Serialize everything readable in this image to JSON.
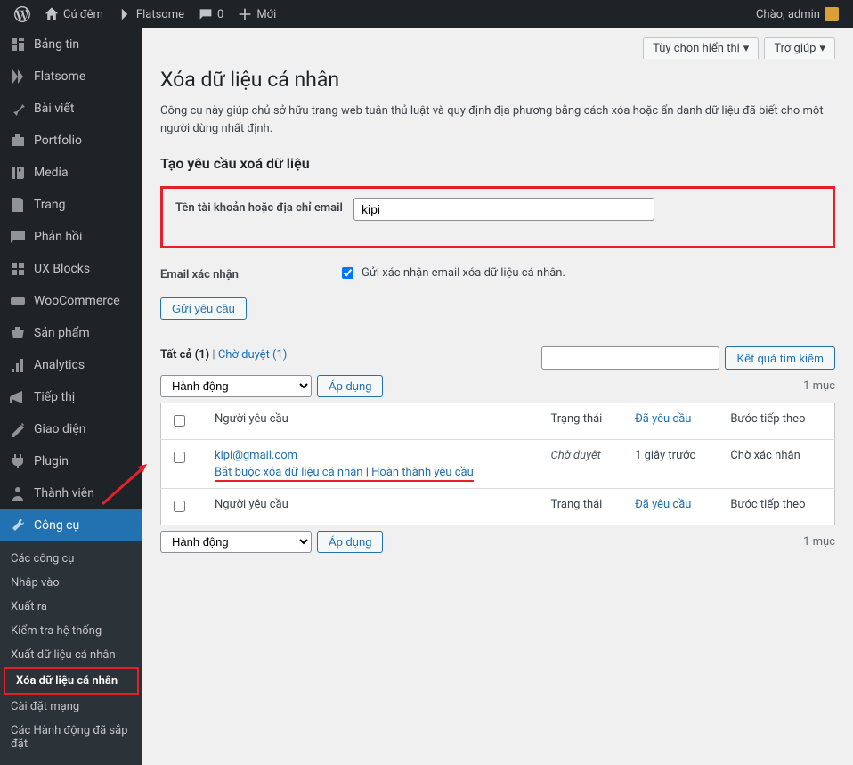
{
  "toolbar": {
    "site_name": "Cú đêm",
    "customize": "Flatsome",
    "comments_count": "0",
    "new": "Mới",
    "greeting": "Chào, admin"
  },
  "sidebar": {
    "items": [
      {
        "icon": "dashboard",
        "label": "Bảng tin"
      },
      {
        "icon": "flatsome",
        "label": "Flatsome"
      },
      {
        "icon": "pin",
        "label": "Bài viết"
      },
      {
        "icon": "portfolio",
        "label": "Portfolio"
      },
      {
        "icon": "media",
        "label": "Media"
      },
      {
        "icon": "page",
        "label": "Trang"
      },
      {
        "icon": "comment",
        "label": "Phản hồi"
      },
      {
        "icon": "block",
        "label": "UX Blocks"
      },
      {
        "icon": "woo",
        "label": "WooCommerce"
      },
      {
        "icon": "product",
        "label": "Sản phẩm"
      },
      {
        "icon": "analytics",
        "label": "Analytics"
      },
      {
        "icon": "marketing",
        "label": "Tiếp thị"
      },
      {
        "icon": "appearance",
        "label": "Giao diện"
      },
      {
        "icon": "plugin",
        "label": "Plugin"
      },
      {
        "icon": "users",
        "label": "Thành viên"
      },
      {
        "icon": "tools",
        "label": "Công cụ"
      }
    ],
    "submenu": [
      "Các công cụ",
      "Nhập vào",
      "Xuất ra",
      "Kiểm tra hệ thống",
      "Xuất dữ liệu cá nhân",
      "Xóa dữ liệu cá nhân",
      "Cài đặt mạng",
      "Các Hành động đã sắp đặt"
    ],
    "submenu_current_index": 5
  },
  "screen": {
    "screen_options": "Tùy chọn hiển thị",
    "help": "Trợ giúp",
    "title": "Xóa dữ liệu cá nhân",
    "description": "Công cụ này giúp chủ sở hữu trang web tuân thủ luật và quy định địa phương bằng cách xóa hoặc ẩn danh dữ liệu đã biết cho một người dùng nhất định.",
    "section_heading": "Tạo yêu cầu xoá dữ liệu",
    "field_label": "Tên tài khoản hoặc địa chỉ email",
    "field_value": "kipi",
    "confirm_label": "Email xác nhận",
    "confirm_checkbox": "Gửi xác nhận email xóa dữ liệu cá nhân.",
    "submit": "Gửi yêu cầu"
  },
  "list": {
    "filters": {
      "all_label": "Tất cả",
      "all_count": "1",
      "pending_label": "Chờ duyệt",
      "pending_count": "1"
    },
    "search_button": "Kết quả tìm kiếm",
    "bulk_placeholder": "Hành động",
    "apply": "Áp dụng",
    "count_text": "1 mục",
    "columns": {
      "requester": "Người yêu cầu",
      "status": "Trạng thái",
      "requested": "Đã yêu cầu",
      "next": "Bước tiếp theo"
    },
    "rows": [
      {
        "email": "kipi@gmail.com",
        "status": "Chờ duyệt",
        "requested": "1 giây trước",
        "next": "Chờ xác nhận",
        "actions": {
          "force": "Bắt buộc xóa dữ liệu cá nhân",
          "complete": "Hoàn thành yêu cầu"
        }
      }
    ]
  }
}
